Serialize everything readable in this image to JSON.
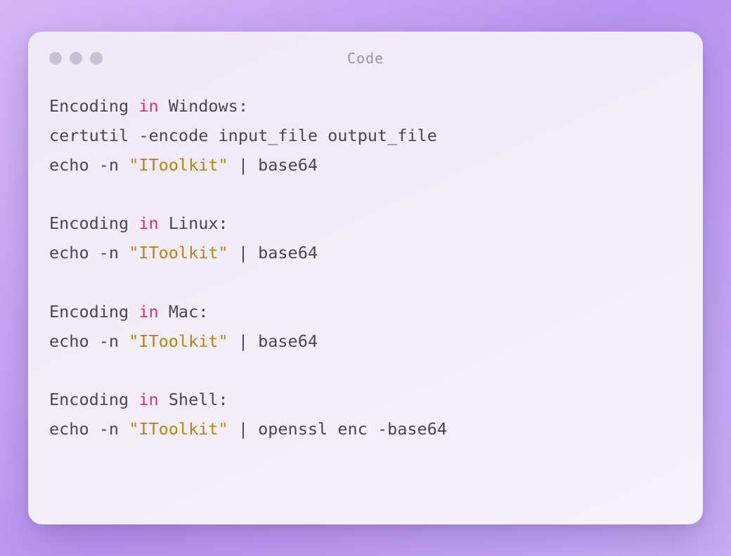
{
  "window": {
    "title": "Code"
  },
  "code": {
    "sections": [
      {
        "label_pre": "Encoding ",
        "label_kw": "in",
        "label_post": " Windows:",
        "lines": [
          [
            {
              "t": "plain",
              "v": "certutil -encode input_file output_file"
            }
          ],
          [
            {
              "t": "plain",
              "v": "echo -n "
            },
            {
              "t": "str",
              "v": "\"IToolkit\""
            },
            {
              "t": "plain",
              "v": " | base64"
            }
          ]
        ]
      },
      {
        "label_pre": "Encoding ",
        "label_kw": "in",
        "label_post": " Linux:",
        "lines": [
          [
            {
              "t": "plain",
              "v": "echo -n "
            },
            {
              "t": "str",
              "v": "\"IToolkit\""
            },
            {
              "t": "plain",
              "v": " | base64"
            }
          ]
        ]
      },
      {
        "label_pre": "Encoding ",
        "label_kw": "in",
        "label_post": " Mac:",
        "lines": [
          [
            {
              "t": "plain",
              "v": "echo -n "
            },
            {
              "t": "str",
              "v": "\"IToolkit\""
            },
            {
              "t": "plain",
              "v": " | base64"
            }
          ]
        ]
      },
      {
        "label_pre": "Encoding ",
        "label_kw": "in",
        "label_post": " Shell:",
        "lines": [
          [
            {
              "t": "plain",
              "v": "echo -n "
            },
            {
              "t": "str",
              "v": "\"IToolkit\""
            },
            {
              "t": "plain",
              "v": " | openssl enc -base64"
            }
          ]
        ]
      }
    ]
  }
}
